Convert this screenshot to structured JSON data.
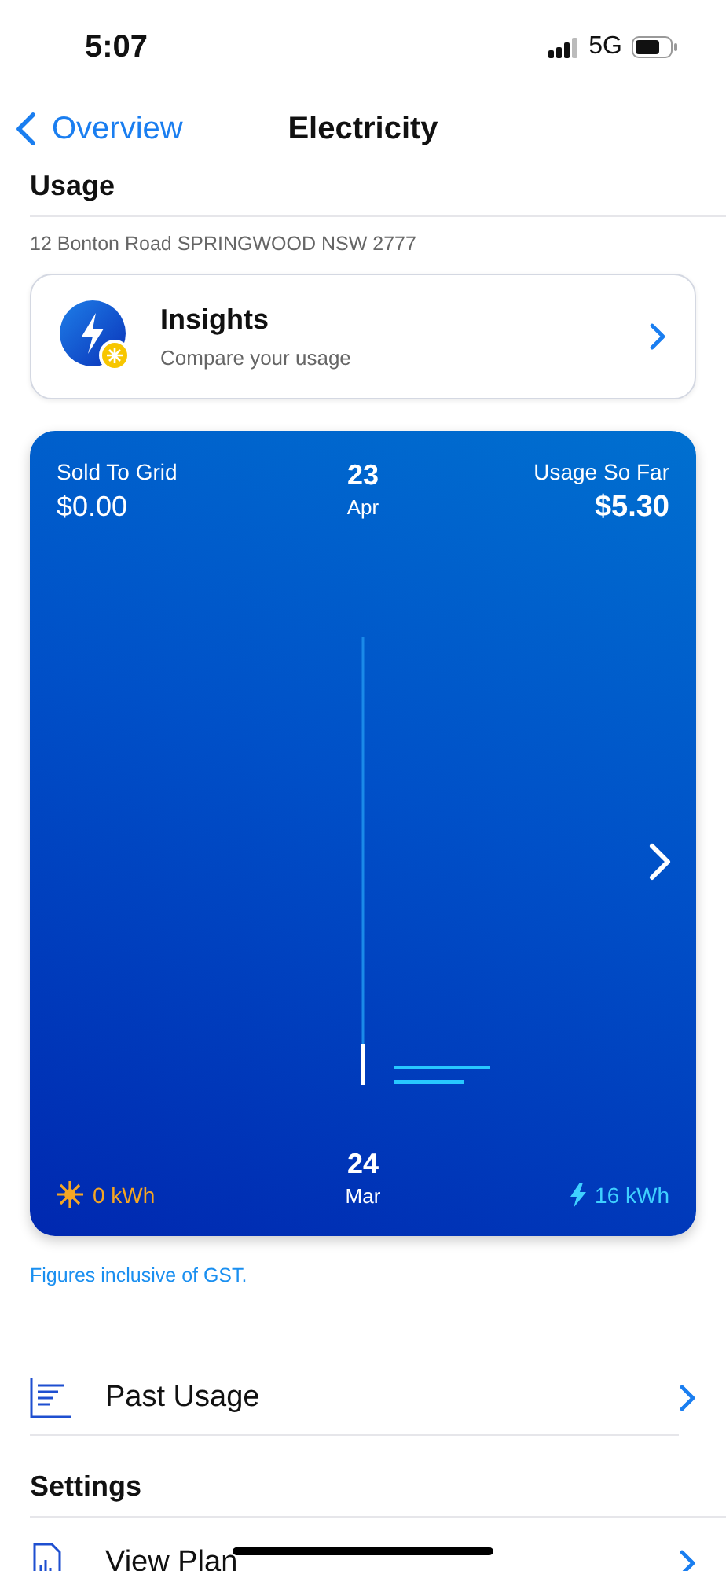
{
  "status_bar": {
    "time": "5:07",
    "network": "5G"
  },
  "nav": {
    "back": "Overview",
    "title": "Electricity"
  },
  "usage": {
    "heading": "Usage",
    "address": "12 Bonton Road SPRINGWOOD NSW 2777"
  },
  "insights": {
    "title": "Insights",
    "subtitle": "Compare your usage"
  },
  "usage_card": {
    "sold_label": "Sold To Grid",
    "sold_value": "$0.00",
    "top_day": "23",
    "top_month": "Apr",
    "usage_label": "Usage So Far",
    "usage_value": "$5.30",
    "bottom_day": "24",
    "bottom_month": "Mar",
    "solar": "0 kWh",
    "grid": "16 kWh"
  },
  "note": "Figures inclusive of GST.",
  "past_usage": {
    "label": "Past Usage"
  },
  "settings": {
    "heading": "Settings",
    "items": [
      {
        "label": "View Plan"
      }
    ]
  }
}
